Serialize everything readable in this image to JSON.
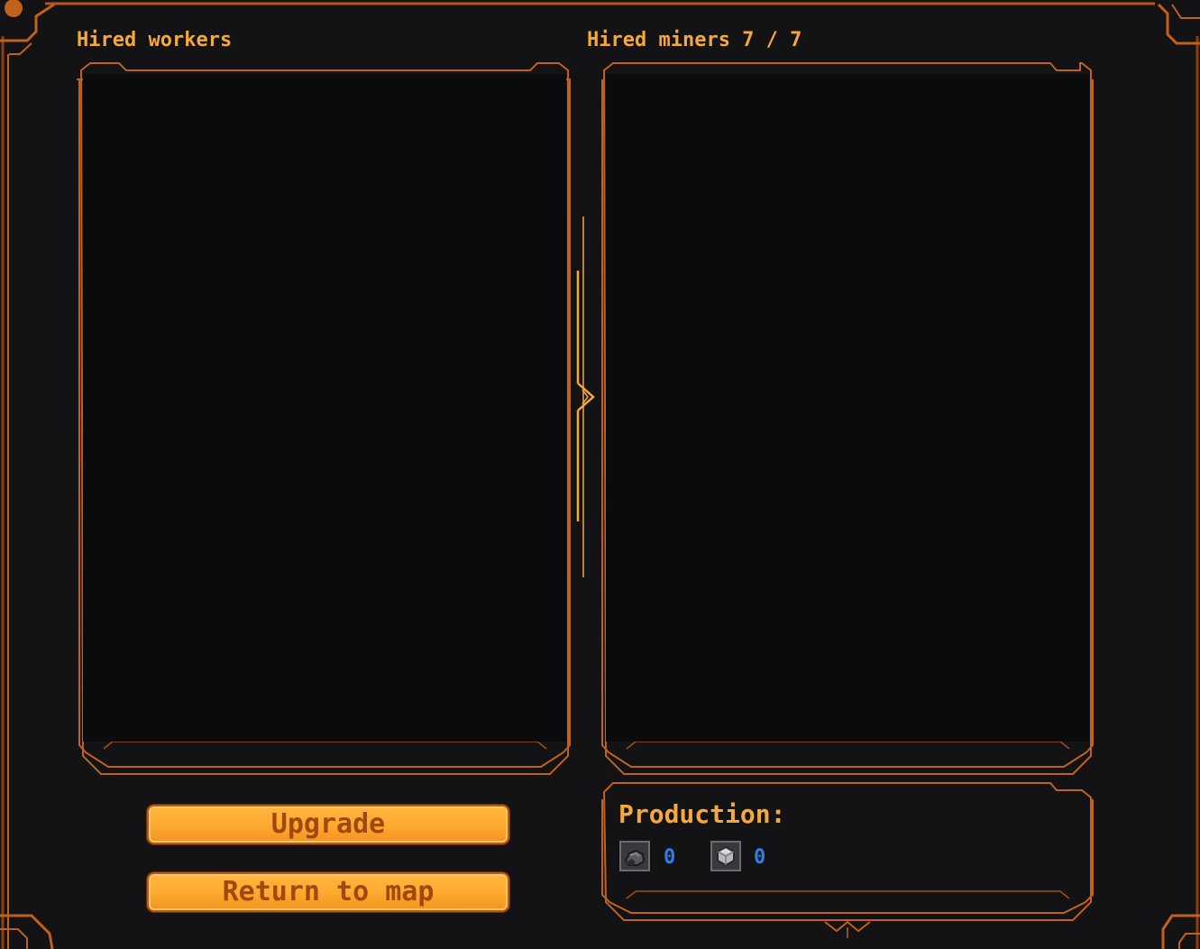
{
  "left_panel": {
    "title": "Hired workers"
  },
  "right_panel": {
    "title": "Hired miners 7 / 7"
  },
  "buttons": {
    "upgrade": "Upgrade",
    "return_to_map": "Return to map"
  },
  "production": {
    "title": "Production:",
    "resources": [
      {
        "icon": "coal-ore-icon",
        "count": "0"
      },
      {
        "icon": "iron-ore-icon",
        "count": "0"
      }
    ]
  },
  "colors": {
    "accent": "#f6a83a",
    "frame": "#c0621c",
    "background": "#131214",
    "count": "#2f7fe6"
  }
}
